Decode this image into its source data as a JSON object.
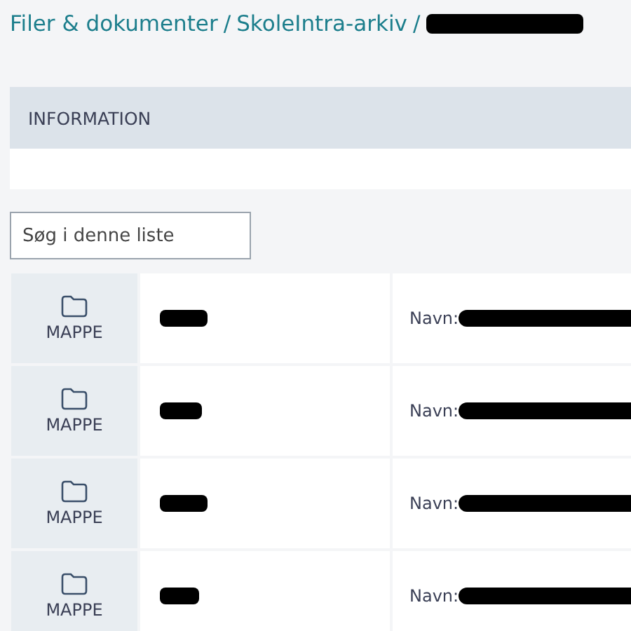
{
  "breadcrumb": [
    {
      "label": "Filer & dokumenter",
      "separator": "/"
    },
    {
      "label": "SkoleIntra-arkiv",
      "separator": "/"
    }
  ],
  "info_panel": {
    "title": "INFORMATION"
  },
  "search": {
    "placeholder": "Søg i denne liste"
  },
  "rows": [
    {
      "type_label": "MAPPE",
      "name_label": "Navn:"
    },
    {
      "type_label": "MAPPE",
      "name_label": "Navn:"
    },
    {
      "type_label": "MAPPE",
      "name_label": "Navn:"
    },
    {
      "type_label": "MAPPE",
      "name_label": "Navn:"
    }
  ]
}
